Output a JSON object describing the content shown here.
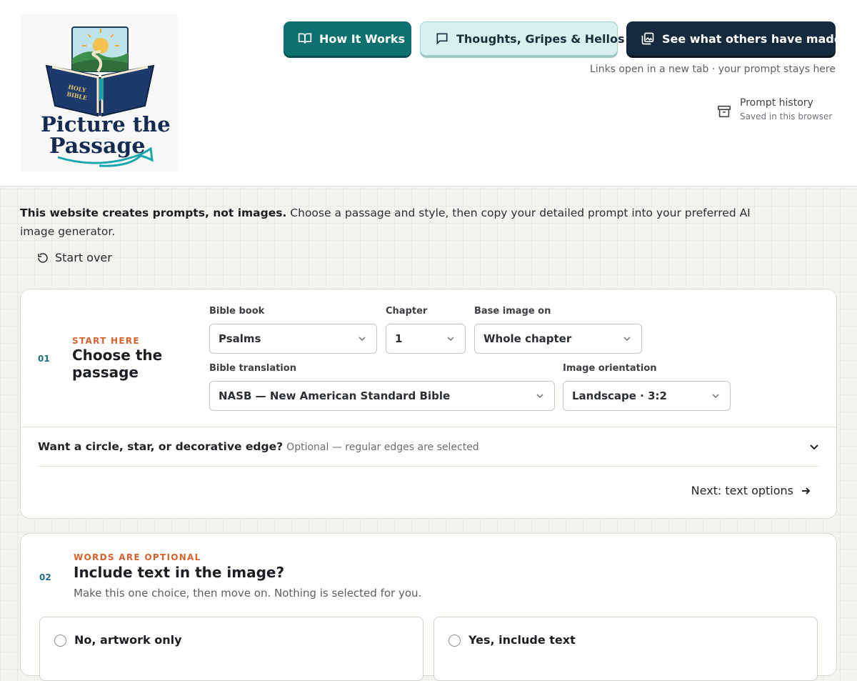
{
  "brand": {
    "logo_text_line1": "Picture the",
    "logo_text_line2": "Passage",
    "book_text_line1": "HOLY",
    "book_text_line2": "BIBLE"
  },
  "nav": {
    "how_it_works": "How It Works",
    "thoughts": "Thoughts, Gripes & Hellos",
    "see_others": "See what others have made",
    "note": "Links open in a new tab · your prompt stays here"
  },
  "history": {
    "title": "Prompt history",
    "subtitle": "Saved in this browser"
  },
  "intro": {
    "bold": "This website creates prompts, not images.",
    "rest": " Choose a passage and style, then copy your detailed prompt into your preferred AI image generator."
  },
  "start_over": "Start over",
  "step1": {
    "number": "01",
    "kicker": "START HERE",
    "title": "Choose the passage",
    "fields": {
      "book": {
        "label": "Bible book",
        "value": "Psalms"
      },
      "chapter": {
        "label": "Chapter",
        "value": "1"
      },
      "base": {
        "label": "Base image on",
        "value": "Whole chapter"
      },
      "translation": {
        "label": "Bible translation",
        "value": "NASB — New American Standard Bible"
      },
      "orientation": {
        "label": "Image orientation",
        "value": "Landscape · 3:2"
      }
    },
    "shape_question": "Want a circle, star, or decorative edge?",
    "shape_optional": "Optional — regular edges are selected",
    "next": "Next: text options"
  },
  "step2": {
    "number": "02",
    "kicker": "WORDS ARE OPTIONAL",
    "title": "Include text in the image?",
    "description": "Make this one choice, then move on. Nothing is selected for you.",
    "options": [
      "No, artwork only",
      "Yes, include text"
    ]
  },
  "colors": {
    "teal": "#0f7070",
    "navy": "#152b3d",
    "accent_orange": "#d4622f",
    "step_number": "#1c6f7d"
  }
}
